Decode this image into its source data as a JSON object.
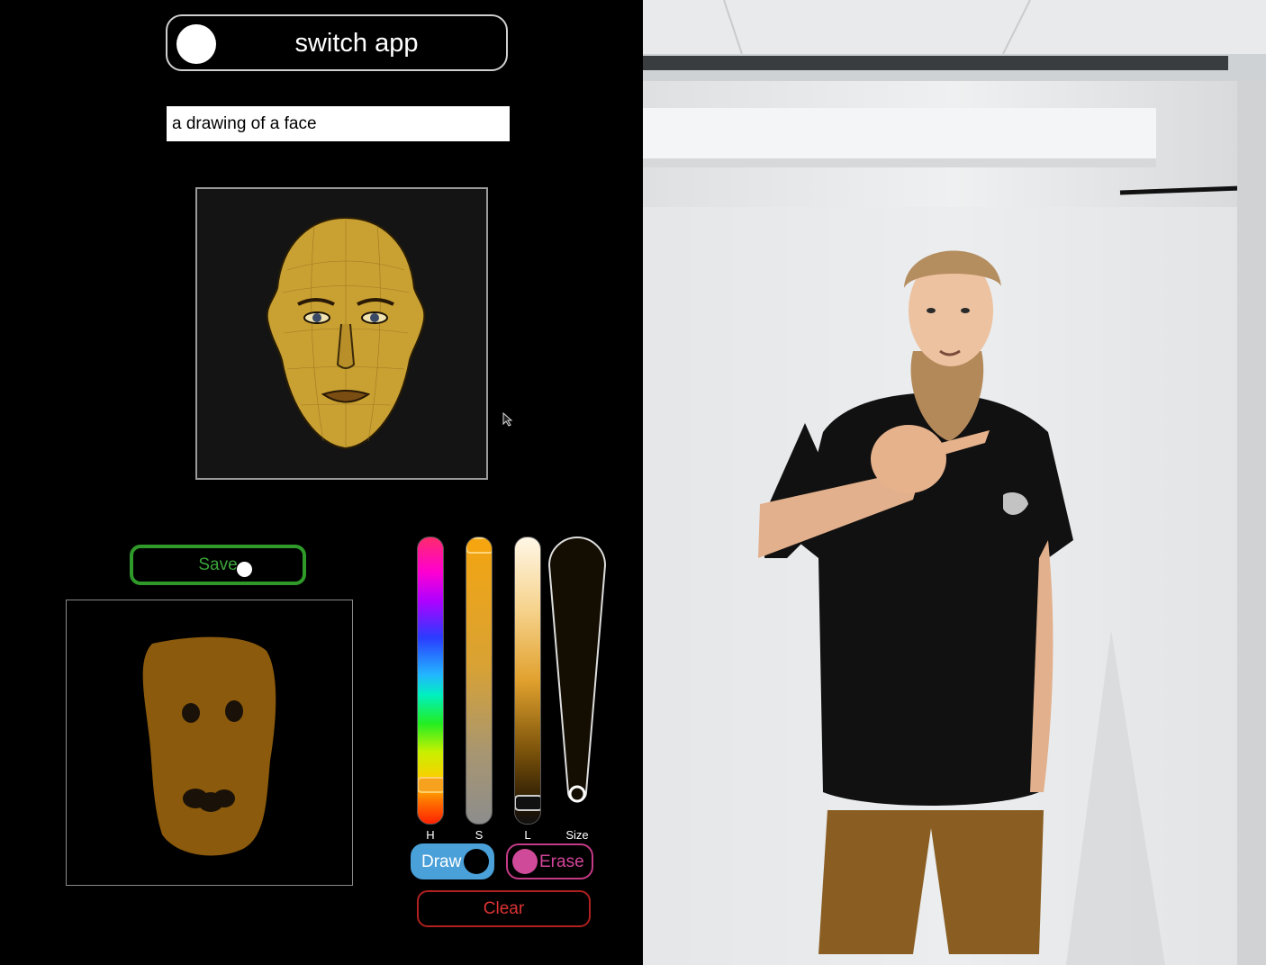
{
  "switch_app": {
    "label": "switch app"
  },
  "prompt": {
    "value": "a drawing of a face"
  },
  "save": {
    "label": "Save"
  },
  "sliders": {
    "h_label": "H",
    "s_label": "S",
    "l_label": "L",
    "size_label": "Size",
    "h_value": 0.9,
    "s_value": 0.03,
    "l_value": 0.93,
    "size_value": 0.95
  },
  "modes": {
    "draw_label": "Draw",
    "erase_label": "Erase",
    "active": "Draw"
  },
  "clear": {
    "label": "Clear"
  },
  "colors": {
    "brush": "#8b5a0c",
    "save_border": "#2f9a2a",
    "draw_accent": "#4aa0d8",
    "erase_accent": "#c43a86",
    "clear_accent": "#b02020",
    "face_tone": "#c9a032"
  }
}
